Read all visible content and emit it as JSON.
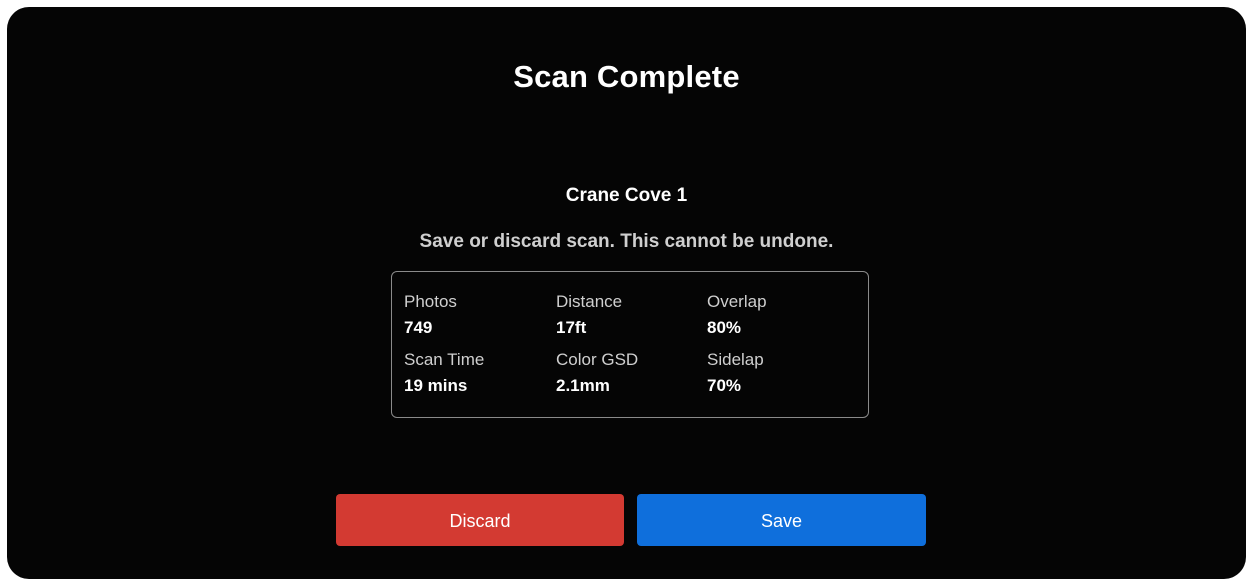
{
  "dialog": {
    "title": "Scan Complete",
    "scan_name": "Crane Cove 1",
    "warning": "Save or discard scan. This cannot be undone."
  },
  "stats": [
    {
      "label": "Photos",
      "value": "749"
    },
    {
      "label": "Distance",
      "value": "17ft"
    },
    {
      "label": "Overlap",
      "value": "80%"
    },
    {
      "label": "Scan Time",
      "value": "19 mins"
    },
    {
      "label": "Color GSD",
      "value": "2.1mm"
    },
    {
      "label": "Sidelap",
      "value": "70%"
    }
  ],
  "buttons": {
    "discard_label": "Discard",
    "save_label": "Save"
  },
  "colors": {
    "background": "#050505",
    "discard": "#d33a32",
    "save": "#0f6fdc"
  }
}
